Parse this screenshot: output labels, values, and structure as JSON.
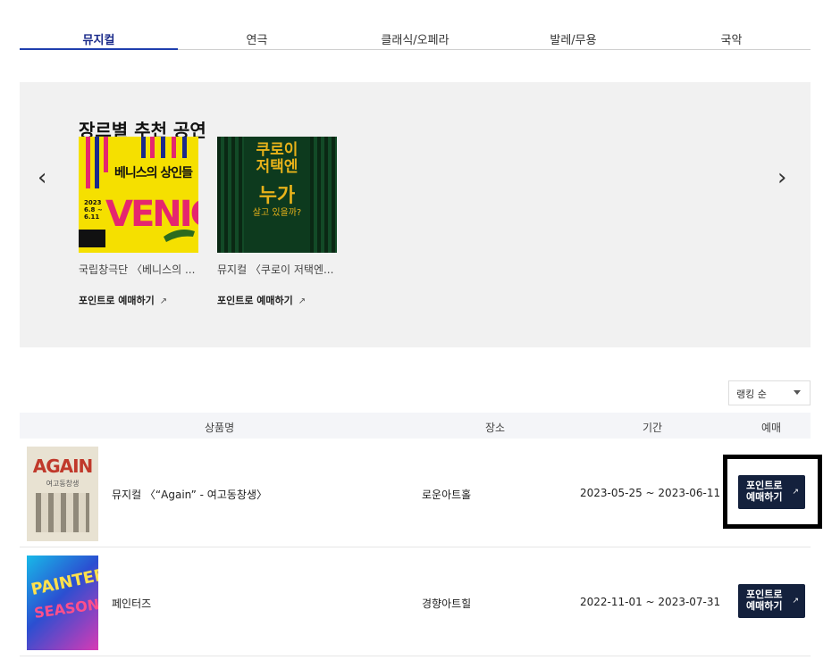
{
  "tabs": [
    {
      "label": "뮤지컬",
      "active": true
    },
    {
      "label": "연극",
      "active": false
    },
    {
      "label": "클래식/오페라",
      "active": false
    },
    {
      "label": "발레/무용",
      "active": false
    },
    {
      "label": "국악",
      "active": false
    }
  ],
  "recommend": {
    "title": "장르별 추천 공연",
    "prev_icon": "chevron-left-icon",
    "next_icon": "chevron-right-icon",
    "items": [
      {
        "name": "국립창극단 〈베니스의 ...",
        "book_label": "포인트로 예매하기",
        "poster_text": "베니스의 상인들",
        "poster_big": "VENICE",
        "poster_dates": "2023\n6.8 ~\n6.11",
        "poster_color": "#f5e000"
      },
      {
        "name": "뮤지컬 〈쿠로이 저택엔...",
        "book_label": "포인트로 예매하기",
        "poster_line1": "쿠로이\n저택엔",
        "poster_line2": "누가",
        "poster_line3": "살고 있을까?",
        "poster_color": "#0d3a1e"
      }
    ]
  },
  "sort": {
    "label": "랭킹 순"
  },
  "table": {
    "headers": {
      "name": "상품명",
      "venue": "장소",
      "period": "기간",
      "booking": "예매"
    },
    "rows": [
      {
        "title": "뮤지컬 〈“Again” - 여고동창생〉",
        "venue": "로운아트홀",
        "period": "2023-05-25 ~ 2023-06-11",
        "button_line1": "포인트로",
        "button_line2": "예매하기",
        "thumb_text": "AGAIN",
        "thumb_sub": "여고동창생"
      },
      {
        "title": "페인터즈",
        "venue": "경향아트힐",
        "period": "2022-11-01 ~ 2023-07-31",
        "button_line1": "포인트로",
        "button_line2": "예매하기",
        "thumb_text": "PAINTERS",
        "thumb_sub": "SEASON"
      }
    ]
  },
  "colors": {
    "accent": "#1f3fae",
    "button_bg": "#14213d",
    "panel_bg": "#f1f1f1"
  }
}
